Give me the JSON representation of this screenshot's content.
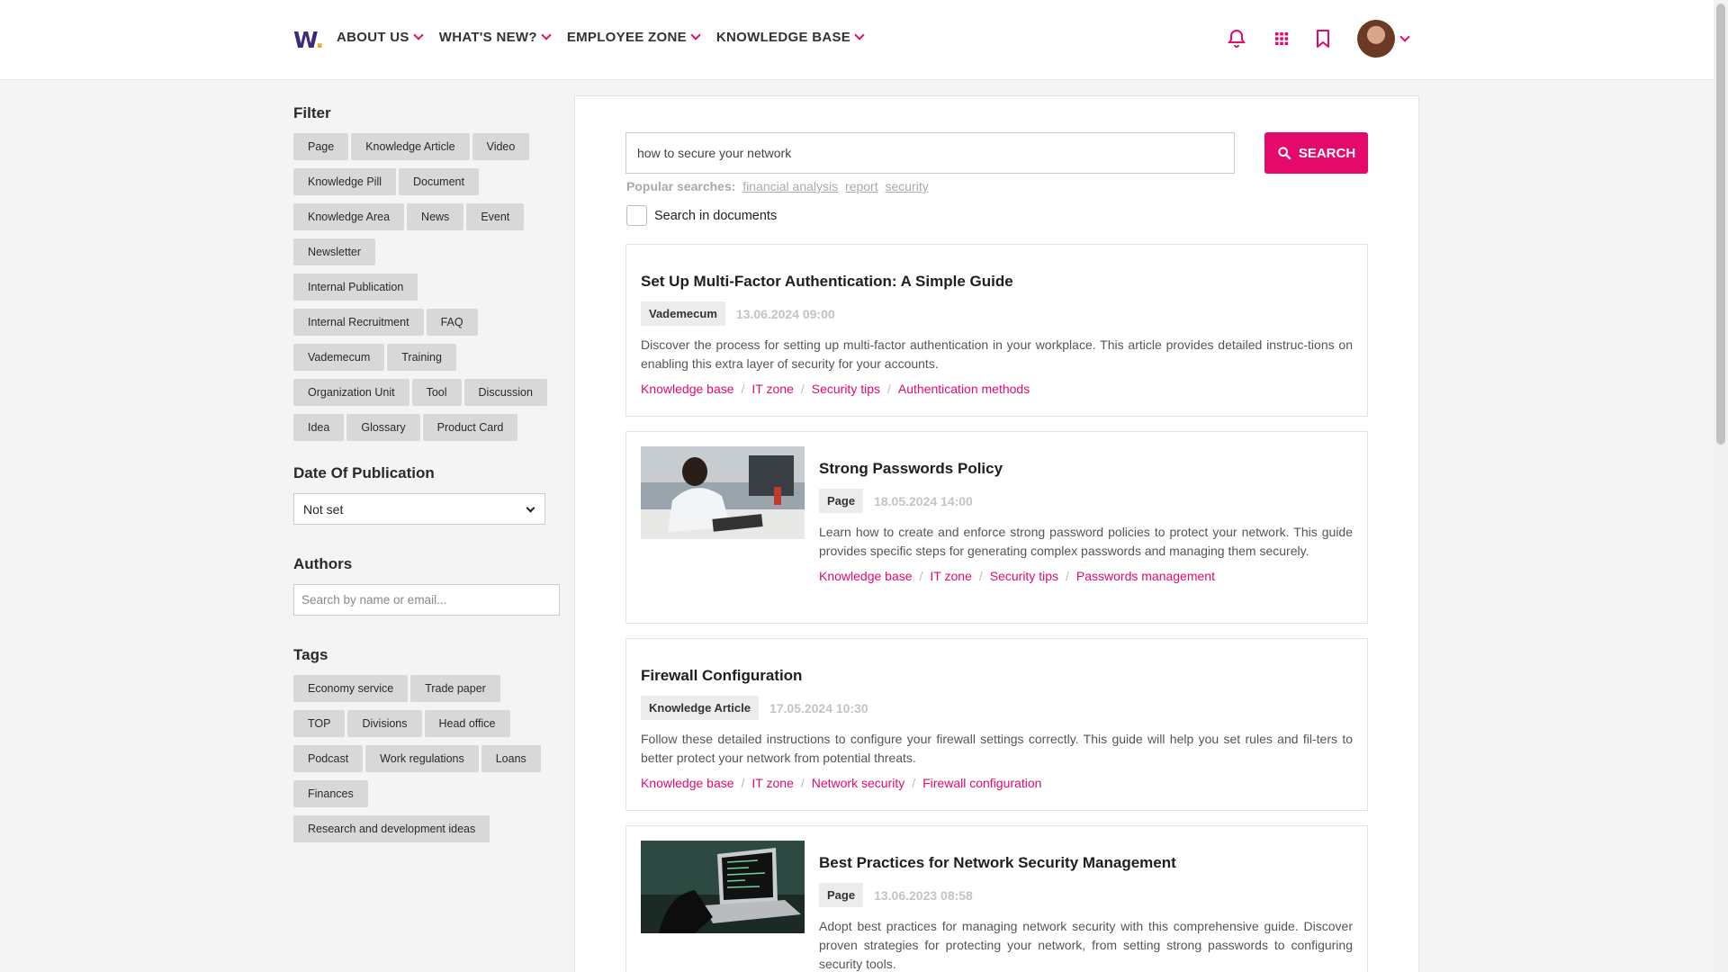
{
  "logo": {
    "letter": "W",
    "dot": "."
  },
  "nav": {
    "items": [
      "ABOUT US",
      "WHAT'S NEW?",
      "EMPLOYEE ZONE",
      "KNOWLEDGE BASE"
    ]
  },
  "colors": {
    "accent": "#e5096b",
    "brand": "#3d2a7a"
  },
  "icons": {
    "notifications": "bell-icon",
    "apps": "grid-icon",
    "saved": "bookmark-icon"
  },
  "sidebar": {
    "filter_title": "Filter",
    "filters": [
      "Page",
      "Knowledge Article",
      "Video",
      "Knowledge Pill",
      "Document",
      "Knowledge Area",
      "News",
      "Event",
      "Newsletter",
      "Internal Publication",
      "Internal Recruitment",
      "FAQ",
      "Vademecum",
      "Training",
      "Organization Unit",
      "Tool",
      "Discussion",
      "Idea",
      "Glossary",
      "Product Card"
    ],
    "date_title": "Date Of Publication",
    "date_value": "Not set",
    "authors_title": "Authors",
    "authors_placeholder": "Search by name or email...",
    "tags_title": "Tags",
    "tags": [
      "Economy service",
      "Trade paper",
      "TOP",
      "Divisions",
      "Head office",
      "Podcast",
      "Work regulations",
      "Loans",
      "Finances",
      "Research and development ideas"
    ]
  },
  "search": {
    "query": "how to secure your network",
    "button_label": "SEARCH",
    "popular_label": "Popular searches:",
    "popular": [
      "financial analysis",
      "report",
      "security"
    ],
    "documents_label": "Search in documents"
  },
  "results": [
    {
      "title": "Set Up Multi-Factor Authentication: A Simple Guide",
      "type": "Vademecum",
      "date": "13.06.2024 09:00",
      "text": "Discover the process for setting up multi-factor authentication in your workplace. This article provides detailed instruc-tions on enabling this extra layer of security for your accounts.",
      "crumbs": [
        "Knowledge base",
        "IT zone",
        "Security tips",
        "Authentication methods"
      ]
    },
    {
      "title": "Strong Passwords Policy",
      "type": "Page",
      "date": "18.05.2024 14:00",
      "text": "Learn how to create and enforce strong password policies to protect your network. This guide provides specific steps for generating complex passwords and managing them securely.",
      "crumbs": [
        "Knowledge base",
        "IT zone",
        "Security tips",
        "Passwords management"
      ]
    },
    {
      "title": "Firewall Configuration",
      "type": "Knowledge Article",
      "date": "17.05.2024 10:30",
      "text": "Follow these detailed instructions to configure your firewall settings correctly. This guide will help you set rules and fil-ters to better protect your network from potential threats.",
      "crumbs": [
        "Knowledge base",
        "IT zone",
        "Network security",
        "Firewall configuration"
      ]
    },
    {
      "title": "Best Practices for Network Security Management",
      "type": "Page",
      "date": "13.06.2023 08:58",
      "text": "Adopt best practices for managing network security with this comprehensive guide. Discover proven strategies for protecting your network, from setting strong passwords to configuring security tools."
    }
  ]
}
